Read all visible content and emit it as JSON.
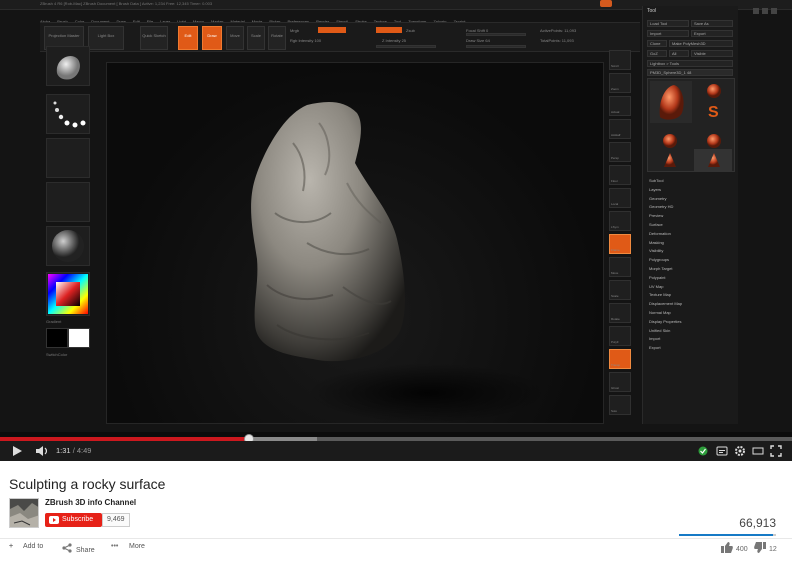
{
  "zbrush": {
    "window_title": "ZBrush 4 R6 [Rob-Mac] ZBrush Document   [ Brush Data ] Active: 1,234 Free: 12,345 Timer: 0.003",
    "menus": [
      "Alpha",
      "Brush",
      "Color",
      "Document",
      "Draw",
      "Edit",
      "File",
      "Layer",
      "Light",
      "Macro",
      "Marker",
      "Material",
      "Movie",
      "Picker",
      "Preferences",
      "Render",
      "Stencil",
      "Stroke",
      "Texture",
      "Tool",
      "Transform",
      "Zplugin",
      "Zscript"
    ],
    "shelf": {
      "projection_master": "Projection Master",
      "lightbox": "Light Box",
      "quick_sketch": "Quick Sketch",
      "edit": "Edit",
      "draw": "Draw",
      "move": "Move",
      "scale": "Scale",
      "rotate": "Rotate",
      "mrgb": "Mrgb",
      "rgb": "Rgb",
      "m": "M",
      "zadd": "Zadd",
      "zsub": "Zsub",
      "zcut": "Zcut",
      "focal_shift": "Focal Shift 0",
      "draw_size": "Draw Size 64",
      "active_points": "ActivePoints: 11,093",
      "total_points": "TotalPoints: 11,093",
      "rgb_intensity": "Rgb Intensity 100",
      "z_intensity": "Z Intensity 25"
    },
    "tool_panel": {
      "header": "Tool",
      "load_tool": "Load Tool",
      "save_as": "Save As",
      "import": "Import",
      "export": "Export",
      "clone": "Clone",
      "make_polymesh": "Make PolyMesh3D",
      "goz": "GoZ",
      "all": "All",
      "visible": "Visible",
      "lightbox_tools": "Lightbox > Tools",
      "current_tool": "PM3D_Sphere3D_1 48",
      "menu_items": [
        "SubTool",
        "Layers",
        "Geometry",
        "Geometry HD",
        "Preview",
        "Surface",
        "Deformation",
        "Masking",
        "Visibility",
        "Polygroups",
        "Morph Target",
        "Polypaint",
        "UV Map",
        "Texture Map",
        "Displacement Map",
        "Normal Map",
        "Display Properties",
        "Unified Skin",
        "Import",
        "Export"
      ]
    },
    "left_labels": {
      "gradient": "Gradient",
      "switch_color": "SwitchColor"
    },
    "right_icons": [
      "Scroll",
      "Zoom",
      "Actual",
      "AAHalf",
      "Persp",
      "Floor",
      "Local",
      "LSym",
      "Frame",
      "Move",
      "Scale",
      "Rotate",
      "PolyF",
      "Transp",
      "Ghost",
      "Solo"
    ]
  },
  "player": {
    "current_time": "1:31",
    "duration": "/ 4:49",
    "progress": 0.3149,
    "buffered": 0.4
  },
  "video": {
    "title": "Sculpting a rocky surface",
    "channel": "ZBrush 3D info Channel",
    "subscribe_label": "Subscribe",
    "subscriber_count": "9,469",
    "views": "66,913",
    "like_ratio": 0.97,
    "likes": "400",
    "dislikes": "12",
    "actions": {
      "add_to": "Add to",
      "share": "Share",
      "more": "More"
    }
  },
  "colors": {
    "accent_red": "#cc181e",
    "zbrush_orange": "#e05a17",
    "sentiment_blue": "#167ac6"
  }
}
